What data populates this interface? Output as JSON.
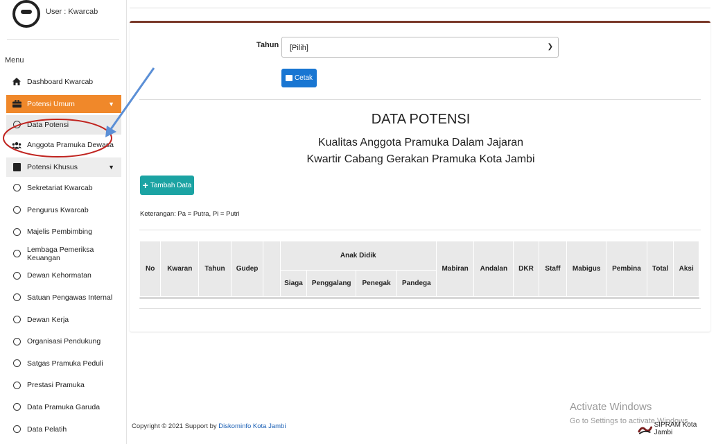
{
  "user": {
    "label": "User : Kwarcab"
  },
  "sidebar": {
    "menu_title": "Menu",
    "items": [
      {
        "label": "Dashboard Kwarcab",
        "icon": "home-icon"
      },
      {
        "label": "Potensi Umum",
        "icon": "briefcase-icon",
        "state": "active"
      },
      {
        "label": "Data Potensi",
        "icon": "circle-icon"
      },
      {
        "label": "Anggota Pramuka Dewasa",
        "icon": "users-icon"
      },
      {
        "label": "Potensi Khusus",
        "icon": "book-icon"
      },
      {
        "label": "Sekretariat Kwarcab",
        "icon": "circle-icon"
      },
      {
        "label": "Pengurus Kwarcab",
        "icon": "circle-icon"
      },
      {
        "label": "Majelis Pembimbing",
        "icon": "circle-icon"
      },
      {
        "label": "Lembaga Pemeriksa Keuangan",
        "icon": "circle-icon"
      },
      {
        "label": "Dewan Kehormatan",
        "icon": "circle-icon"
      },
      {
        "label": "Satuan Pengawas Internal",
        "icon": "circle-icon"
      },
      {
        "label": "Dewan Kerja",
        "icon": "circle-icon"
      },
      {
        "label": "Organisasi Pendukung",
        "icon": "circle-icon"
      },
      {
        "label": "Satgas Pramuka Peduli",
        "icon": "circle-icon"
      },
      {
        "label": "Prestasi Pramuka",
        "icon": "circle-icon"
      },
      {
        "label": "Data Pramuka Garuda",
        "icon": "circle-icon"
      },
      {
        "label": "Data Pelatih",
        "icon": "circle-icon"
      }
    ]
  },
  "filter": {
    "tahun_label": "Tahun",
    "tahun_value": "[Pilih]"
  },
  "buttons": {
    "cetak": "Cetak",
    "tambah": "Tambah Data"
  },
  "heading": {
    "title": "DATA POTENSI",
    "line1": "Kualitas Anggota Pramuka Dalam Jajaran",
    "line2": "Kwartir Cabang Gerakan Pramuka Kota Jambi"
  },
  "keterangan": "Keterangan: Pa = Putra, Pi = Putri",
  "table": {
    "col_no": "No",
    "col_kwaran": "Kwaran",
    "col_tahun": "Tahun",
    "col_gudep": "Gudep",
    "group_anak_didik": "Anak Didik",
    "sub_siaga": "Siaga",
    "sub_penggalang": "Penggalang",
    "sub_penegak": "Penegak",
    "sub_pandega": "Pandega",
    "col_mabiran": "Mabiran",
    "col_andalan": "Andalan",
    "col_dkr": "DKR",
    "col_staff": "Staff",
    "col_mabigus": "Mabigus",
    "col_pembina": "Pembina",
    "col_total": "Total",
    "col_aksi": "Aksi"
  },
  "footer": {
    "copyright": "Copyright © 2021 Support by ",
    "link": "Diskominfo Kota Jambi",
    "brand": "SIPRAM Kota Jambi"
  },
  "watermark": {
    "line1": "Activate Windows",
    "line2": "Go to Settings to activate Windows."
  },
  "colors": {
    "active_menu": "#f0882a",
    "primary_button": "#1976d2",
    "teal_button": "#1ba3a3",
    "annotation_red": "#c0231f",
    "annotation_blue": "#5b8fd6"
  }
}
